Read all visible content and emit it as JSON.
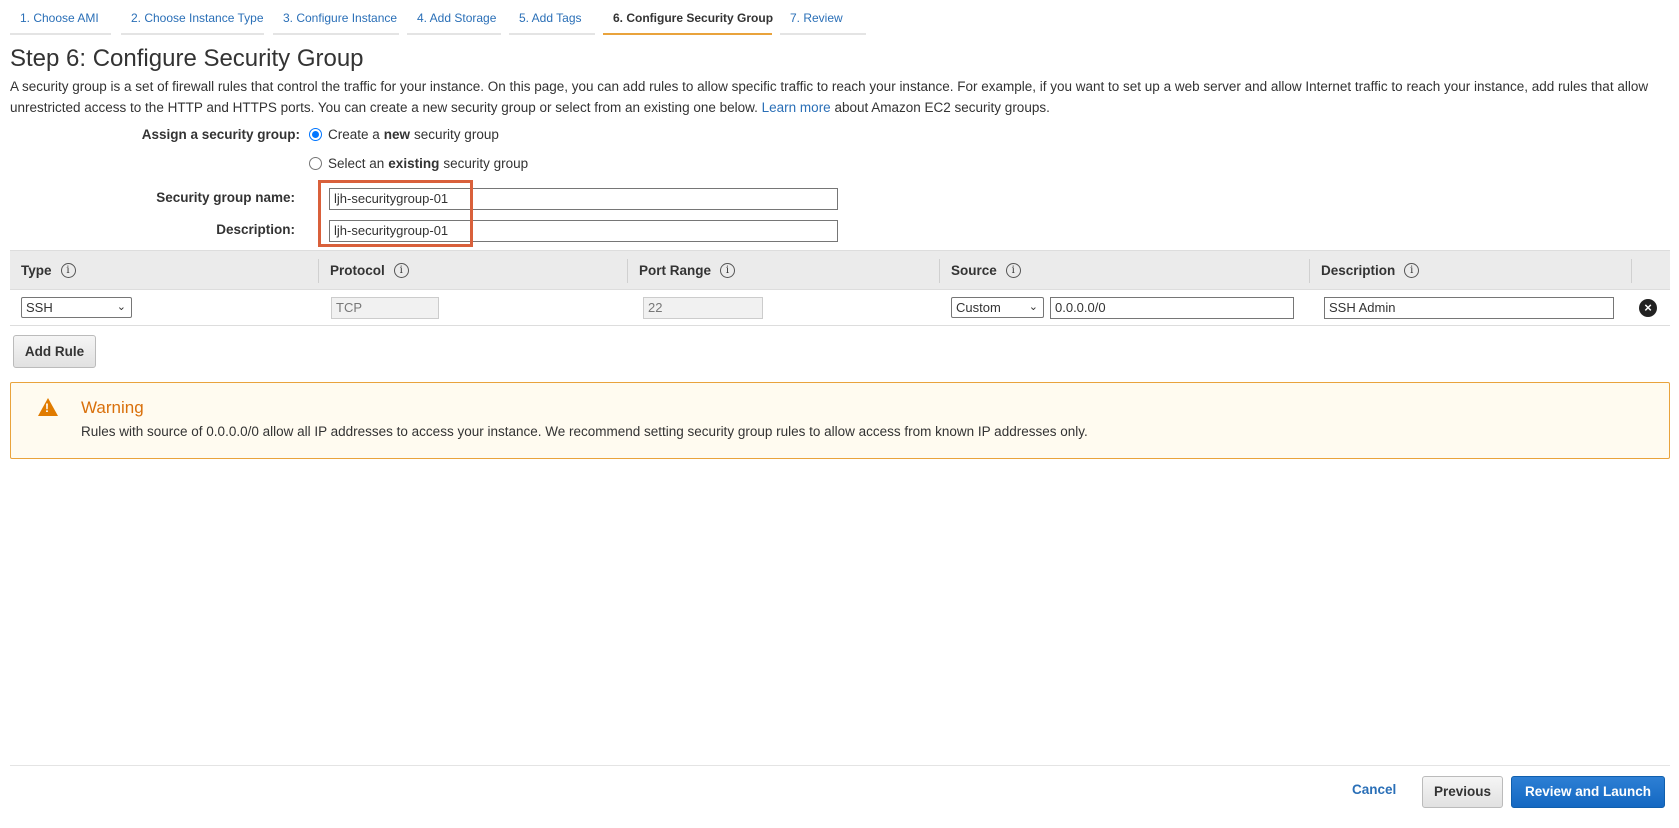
{
  "wizard": {
    "steps": [
      {
        "label": "1. Choose AMI"
      },
      {
        "label": "2. Choose Instance Type"
      },
      {
        "label": "3. Configure Instance"
      },
      {
        "label": "4. Add Storage"
      },
      {
        "label": "5. Add Tags"
      },
      {
        "label": "6. Configure Security Group"
      },
      {
        "label": "7. Review"
      }
    ],
    "active_step": 6
  },
  "page": {
    "title": "Step 6: Configure Security Group",
    "intro": "A security group is a set of firewall rules that control the traffic for your instance. On this page, you can add rules to allow specific traffic to reach your instance. For example, if you want to set up a web server and allow Internet traffic to reach your instance, add rules that allow unrestricted access to the HTTP and HTTPS ports. You can create a new security group or select from an existing one below.",
    "learn_more": "Learn more",
    "intro_tail": "about Amazon EC2 security groups."
  },
  "assign": {
    "label": "Assign a security group:",
    "option_new_pre": "Create a",
    "option_new_bold": "new",
    "option_new_post": "security group",
    "option_existing_pre": "Select an",
    "option_existing_bold": "existing",
    "option_existing_post": "security group",
    "selected": "new"
  },
  "group": {
    "name_label": "Security group name:",
    "name_value": "ljh-securitygroup-01",
    "desc_label": "Description:",
    "desc_value": "ljh-securitygroup-01"
  },
  "rules_table": {
    "headers": {
      "type": "Type",
      "protocol": "Protocol",
      "port_range": "Port Range",
      "source": "Source",
      "description": "Description"
    },
    "rows": [
      {
        "type": "SSH",
        "protocol": "TCP",
        "port_range": "22",
        "source_mode": "Custom",
        "source_cidr": "0.0.0.0/0",
        "description": "SSH Admin"
      }
    ],
    "add_rule_label": "Add Rule"
  },
  "warning": {
    "title": "Warning",
    "text": "Rules with source of 0.0.0.0/0 allow all IP addresses to access your instance. We recommend setting security group rules to allow access from known IP addresses only."
  },
  "footer": {
    "cancel": "Cancel",
    "previous": "Previous",
    "review_launch": "Review and Launch"
  },
  "colors": {
    "accent_link": "#2a6fb7",
    "active_tab_underline": "#e9a33c",
    "highlight_box": "#d9603b",
    "warning_border": "#e9a33c",
    "primary_button": "#1468c2"
  },
  "icons": {
    "info": "info-icon",
    "remove": "remove-circle-icon",
    "warning": "warning-triangle-icon",
    "select_caret": "chevron-down-icon"
  }
}
